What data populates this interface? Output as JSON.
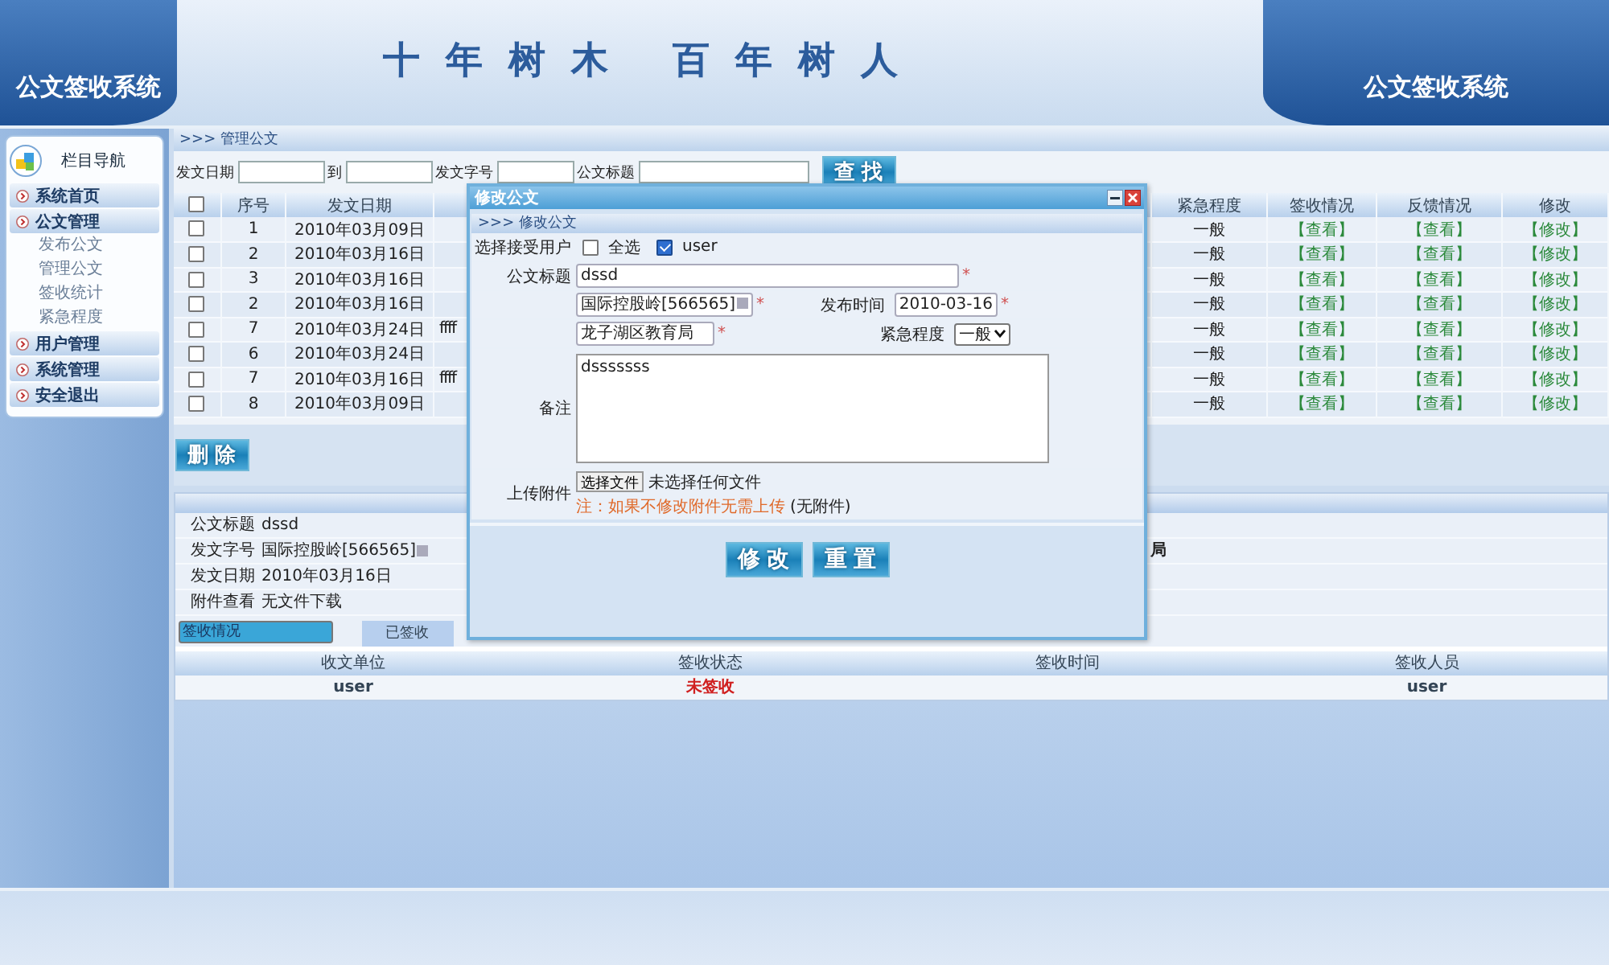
{
  "header": {
    "logo": "公文签收系统",
    "slogan": "十 年 树 木   百 年 树 人",
    "logo_right": "公文签收系统"
  },
  "sidebar": {
    "title": "栏目导航",
    "items": [
      {
        "label": "系统首页"
      },
      {
        "label": "公文管理",
        "children": [
          {
            "label": "发布公文"
          },
          {
            "label": "管理公文"
          },
          {
            "label": "签收统计"
          },
          {
            "label": "紧急程度"
          }
        ]
      },
      {
        "label": "用户管理"
      },
      {
        "label": "系统管理"
      },
      {
        "label": "安全退出"
      }
    ]
  },
  "breadcrumb": ">>> 管理公文",
  "search": {
    "fields": [
      {
        "label": "发文日期"
      },
      {
        "label": "到"
      },
      {
        "label": "发文字号"
      },
      {
        "label": "公文标题"
      }
    ],
    "button": "查找"
  },
  "table": {
    "select_all": {
      "checked": false
    },
    "columns": [
      "序号",
      "发文日期",
      "",
      "紧急程度",
      "签收情况",
      "反馈情况",
      "修改"
    ],
    "rows": [
      {
        "checked": false,
        "num": "1",
        "date": "2010年03月09日",
        "urgency": "一般",
        "sign": "【查看】",
        "feedback": "【查看】",
        "edit": "【修改】"
      },
      {
        "checked": false,
        "num": "2",
        "date": "2010年03月16日",
        "urgency": "一般",
        "sign": "【查看】",
        "feedback": "【查看】",
        "edit": "【修改】"
      },
      {
        "checked": false,
        "num": "3",
        "date": "2010年03月16日",
        "urgency": "一般",
        "sign": "【查看】",
        "feedback": "【查看】",
        "edit": "【修改】"
      },
      {
        "checked": false,
        "num": "2",
        "date": "2010年03月16日",
        "urgency": "一般",
        "sign": "【查看】",
        "feedback": "【查看】",
        "edit": "【修改】"
      },
      {
        "checked": false,
        "num": "7",
        "date": "2010年03月24日",
        "column_4": "ffff",
        "urgency": "一般",
        "sign": "【查看】",
        "feedback": "【查看】",
        "edit": "【修改】"
      },
      {
        "checked": false,
        "num": "6",
        "date": "2010年03月24日",
        "urgency": "一般",
        "sign": "【查看】",
        "feedback": "【查看】",
        "edit": "【修改】"
      },
      {
        "checked": false,
        "num": "7",
        "date": "2010年03月16日",
        "column_4": "ffff",
        "urgency": "一般",
        "sign": "【查看】",
        "feedback": "【查看】",
        "edit": "【修改】"
      },
      {
        "checked": false,
        "num": "8",
        "date": "2010年03月09日",
        "urgency": "一般",
        "sign": "【查看】",
        "feedback": "【查看】",
        "edit": "【修改】"
      }
    ]
  },
  "delete_button": "删除",
  "details": {
    "rows": [
      {
        "label": "公文标题",
        "value": "dssd"
      },
      {
        "label": "发文字号",
        "value": "国际控股岭[566565]",
        "glyph": true,
        "value_2": "局"
      },
      {
        "label": "发文日期",
        "value": "2010年03月16日"
      },
      {
        "label": "附件查看",
        "value": "无文件下载"
      }
    ],
    "tabs": [
      {
        "label": "签收情况",
        "selected": true
      },
      {
        "label": "已签收",
        "selected": false
      }
    ],
    "sign_table": {
      "columns": [
        "收文单位",
        "签收状态",
        "签收时间",
        "签收人员"
      ],
      "rows": [
        {
          "unit": "user",
          "status": "未签收",
          "color": "#d02020",
          "user": "user"
        }
      ]
    }
  },
  "dialog": {
    "title": "修改公文",
    "breadcrumb": ">>> 修改公文",
    "recipients": {
      "label": "选择接受用户",
      "options": [
        {
          "label": "全选",
          "checked": false
        },
        {
          "label": "user",
          "checked": true
        }
      ]
    },
    "title_field": {
      "label": "公文标题",
      "value": "dssd",
      "required_mark": "*"
    },
    "number_field": {
      "value": "国际控股岭[566565]",
      "glyph": true,
      "required_mark": "*"
    },
    "date_field": {
      "label": "发布时间",
      "value": "2010-03-16",
      "required_mark": "*"
    },
    "issuer_field": {
      "value": "龙子湖区教育局",
      "required_mark": "*"
    },
    "urgency_select": {
      "label": "紧急程度",
      "value": "一般"
    },
    "remark": {
      "label": "备注",
      "value": "dsssssss"
    },
    "upload": {
      "label": "上传附件",
      "button": "选择文件",
      "status": "未选择任何文件",
      "note": "注：如果不修改附件无需上传",
      "attachment": "(无附件)"
    },
    "buttons": [
      "修改",
      "重置"
    ]
  }
}
